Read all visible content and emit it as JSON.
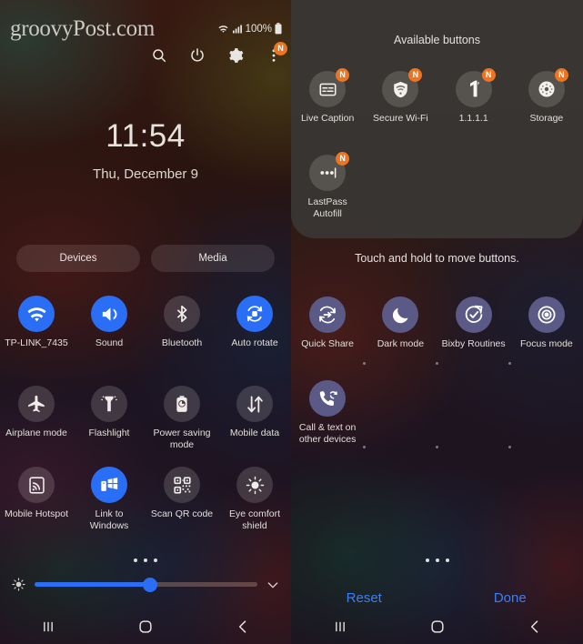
{
  "left": {
    "watermark": "groovyPost.com",
    "status": {
      "battery_pct": "100%",
      "wifi_icon": "wifi-icon",
      "signal_icon": "signal-icon",
      "battery_icon": "battery-icon"
    },
    "header_icons": [
      {
        "name": "search-icon",
        "badge": ""
      },
      {
        "name": "power-icon",
        "badge": ""
      },
      {
        "name": "gear-icon",
        "badge": ""
      },
      {
        "name": "overflow-menu-icon",
        "badge": "N"
      }
    ],
    "clock": {
      "time": "11:54",
      "date": "Thu, December 9"
    },
    "devices_label": "Devices",
    "media_label": "Media",
    "tiles": [
      {
        "label": "TP-LINK_7435",
        "icon": "wifi-icon",
        "state": "on"
      },
      {
        "label": "Sound",
        "icon": "volume-icon",
        "state": "on"
      },
      {
        "label": "Bluetooth",
        "icon": "bluetooth-icon",
        "state": "off"
      },
      {
        "label": "Auto rotate",
        "icon": "auto-rotate-icon",
        "state": "on"
      },
      {
        "label": "Airplane mode",
        "icon": "airplane-icon",
        "state": "off"
      },
      {
        "label": "Flashlight",
        "icon": "flashlight-icon",
        "state": "off"
      },
      {
        "label": "Power saving mode",
        "icon": "battery-saver-icon",
        "state": "off"
      },
      {
        "label": "Mobile data",
        "icon": "data-transfer-icon",
        "state": "off"
      },
      {
        "label": "Mobile Hotspot",
        "icon": "hotspot-icon",
        "state": "off"
      },
      {
        "label": "Link to Windows",
        "icon": "link-to-windows-icon",
        "state": "on"
      },
      {
        "label": "Scan QR code",
        "icon": "qr-code-icon",
        "state": "off"
      },
      {
        "label": "Eye comfort shield",
        "icon": "eye-comfort-icon",
        "state": "off"
      }
    ],
    "brightness": {
      "icon": "brightness-icon",
      "value_pct": 52,
      "expand_icon": "chevron-down-icon"
    },
    "page_dots": 3,
    "nav": [
      "recents-icon",
      "home-icon",
      "back-icon"
    ]
  },
  "right": {
    "available_title": "Available buttons",
    "available_tiles": [
      {
        "label": "Live Caption",
        "icon": "live-caption-icon",
        "badge": "N"
      },
      {
        "label": "Secure Wi-Fi",
        "icon": "secure-wifi-icon",
        "badge": "N"
      },
      {
        "label": "1.1.1.1",
        "icon": "one-one-one-one-icon",
        "badge": "N"
      },
      {
        "label": "Storage",
        "icon": "storage-icon",
        "badge": "N"
      },
      {
        "label": "LastPass Autofill",
        "icon": "lastpass-icon",
        "badge": "N"
      }
    ],
    "hint": "Touch and hold to move buttons.",
    "tiles": [
      {
        "label": "Quick Share",
        "icon": "quick-share-icon",
        "state": "slate"
      },
      {
        "label": "Dark mode",
        "icon": "moon-icon",
        "state": "slate"
      },
      {
        "label": "Bixby Routines",
        "icon": "bixby-routines-icon",
        "state": "slate"
      },
      {
        "label": "Focus mode",
        "icon": "focus-mode-icon",
        "state": "slate"
      },
      {
        "label": "Call & text on other devices",
        "icon": "call-text-other-devices-icon",
        "state": "slate"
      }
    ],
    "reset_label": "Reset",
    "done_label": "Done",
    "page_dots": 3,
    "nav": [
      "recents-icon",
      "home-icon",
      "back-icon"
    ]
  },
  "colors": {
    "accent_blue": "#2a6ef5",
    "link_blue": "#3b7ef7",
    "badge_orange": "#ed7420",
    "slate_tile": "#5b5a86"
  }
}
